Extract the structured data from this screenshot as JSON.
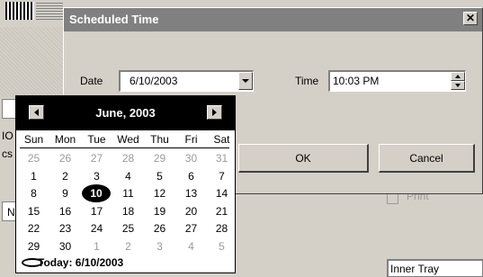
{
  "dialog": {
    "title": "Scheduled Time",
    "close_glyph": "✕",
    "date_label": "Date",
    "date_value": "6/10/2003",
    "time_label": "Time",
    "time_value": "10:03 PM",
    "ok_label": "OK",
    "cancel_label": "Cancel"
  },
  "background": {
    "print_label": "Print",
    "inner_tray_value": "Inner Tray",
    "left_snips": [
      "IO",
      "cs",
      "N"
    ]
  },
  "calendar": {
    "month_title": "June, 2003",
    "days_of_week": [
      "Sun",
      "Mon",
      "Tue",
      "Wed",
      "Thu",
      "Fri",
      "Sat"
    ],
    "weeks": [
      [
        {
          "d": "25",
          "o": true
        },
        {
          "d": "26",
          "o": true
        },
        {
          "d": "27",
          "o": true
        },
        {
          "d": "28",
          "o": true
        },
        {
          "d": "29",
          "o": true
        },
        {
          "d": "30",
          "o": true
        },
        {
          "d": "31",
          "o": true
        }
      ],
      [
        {
          "d": "1"
        },
        {
          "d": "2"
        },
        {
          "d": "3"
        },
        {
          "d": "4"
        },
        {
          "d": "5"
        },
        {
          "d": "6"
        },
        {
          "d": "7"
        }
      ],
      [
        {
          "d": "8"
        },
        {
          "d": "9"
        },
        {
          "d": "10",
          "sel": true
        },
        {
          "d": "11"
        },
        {
          "d": "12"
        },
        {
          "d": "13"
        },
        {
          "d": "14"
        }
      ],
      [
        {
          "d": "15"
        },
        {
          "d": "16"
        },
        {
          "d": "17"
        },
        {
          "d": "18"
        },
        {
          "d": "19"
        },
        {
          "d": "20"
        },
        {
          "d": "21"
        }
      ],
      [
        {
          "d": "22"
        },
        {
          "d": "23"
        },
        {
          "d": "24"
        },
        {
          "d": "25"
        },
        {
          "d": "26"
        },
        {
          "d": "27"
        },
        {
          "d": "28"
        }
      ],
      [
        {
          "d": "29"
        },
        {
          "d": "30"
        },
        {
          "d": "1",
          "o": true
        },
        {
          "d": "2",
          "o": true
        },
        {
          "d": "3",
          "o": true
        },
        {
          "d": "4",
          "o": true
        },
        {
          "d": "5",
          "o": true
        }
      ]
    ],
    "today_text": "Today: 6/10/2003"
  }
}
